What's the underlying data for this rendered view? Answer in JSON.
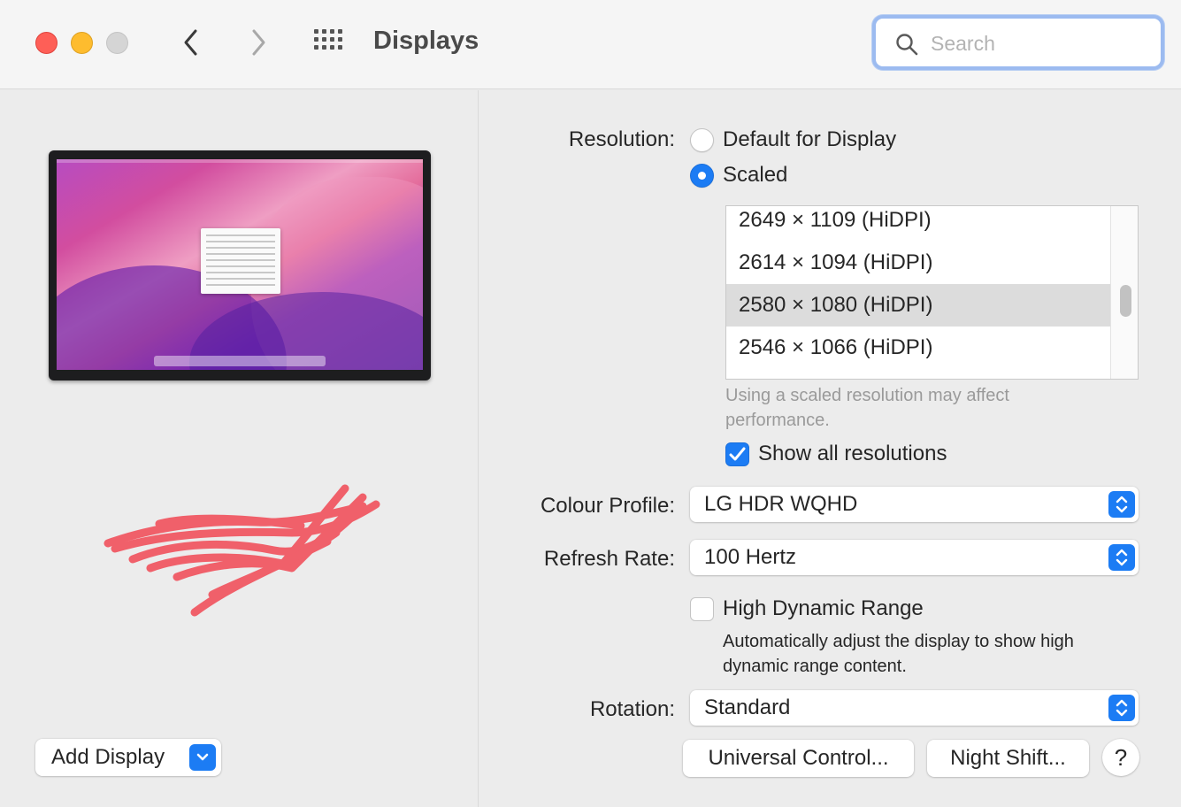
{
  "window": {
    "title": "Displays"
  },
  "search": {
    "placeholder": "Search",
    "value": ""
  },
  "left": {
    "add_display_label": "Add Display"
  },
  "resolution": {
    "label": "Resolution:",
    "options": [
      "Default for Display",
      "Scaled"
    ],
    "selected_option": "Scaled",
    "list": [
      "2649 × 1109 (HiDPI)",
      "2614 × 1094 (HiDPI)",
      "2580 × 1080 (HiDPI)",
      "2546 × 1066 (HiDPI)"
    ],
    "selected_index": 2,
    "note": "Using a scaled resolution may affect performance.",
    "show_all_label": "Show all resolutions",
    "show_all_checked": true
  },
  "colour_profile": {
    "label": "Colour Profile:",
    "value": "LG HDR WQHD"
  },
  "refresh_rate": {
    "label": "Refresh Rate:",
    "value": "100 Hertz"
  },
  "hdr": {
    "label": "High Dynamic Range",
    "checked": false,
    "description": "Automatically adjust the display to show high dynamic range content."
  },
  "rotation": {
    "label": "Rotation:",
    "value": "Standard"
  },
  "buttons": {
    "universal_control": "Universal Control...",
    "night_shift": "Night Shift...",
    "help": "?"
  },
  "colors": {
    "accent": "#1c7cf4",
    "close": "#fe5f57",
    "minimize": "#febc2e",
    "zoom": "#d5d5d5",
    "redaction": "#f0606a"
  },
  "icons": [
    "back-chevron-icon",
    "forward-chevron-icon",
    "show-all-grid-icon",
    "search-icon",
    "chevron-down-icon",
    "updown-chevron-icon",
    "checkmark-icon"
  ]
}
